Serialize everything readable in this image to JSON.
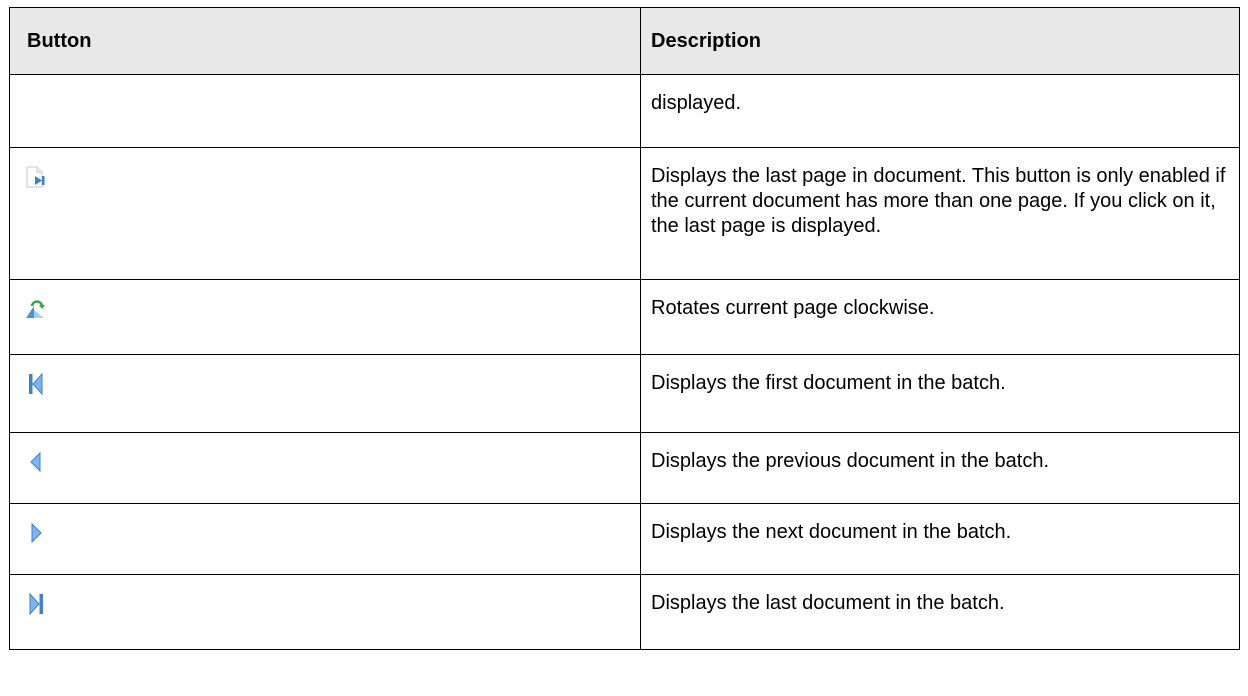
{
  "table": {
    "headers": {
      "button": "Button",
      "description": "Description"
    },
    "rows": [
      {
        "icon": "",
        "description": "displayed."
      },
      {
        "icon": "last-page-icon",
        "description": "Displays the last page in document. This button is only enabled if the current document has more than one page. If you click on it, the last page is displayed."
      },
      {
        "icon": "rotate-clockwise-icon",
        "description": "Rotates current page clockwise."
      },
      {
        "icon": "first-document-icon",
        "description": "Displays the first document in the batch."
      },
      {
        "icon": "previous-document-icon",
        "description": "Displays the previous document in the batch."
      },
      {
        "icon": "next-document-icon",
        "description": "Displays the next document in the batch."
      },
      {
        "icon": "last-document-icon",
        "description": "Displays the last document in the batch."
      }
    ]
  },
  "colors": {
    "header_bg": "#e8e8e8",
    "border": "#000000",
    "icon_blue": "#4a90e2",
    "icon_green": "#3aa64a"
  }
}
